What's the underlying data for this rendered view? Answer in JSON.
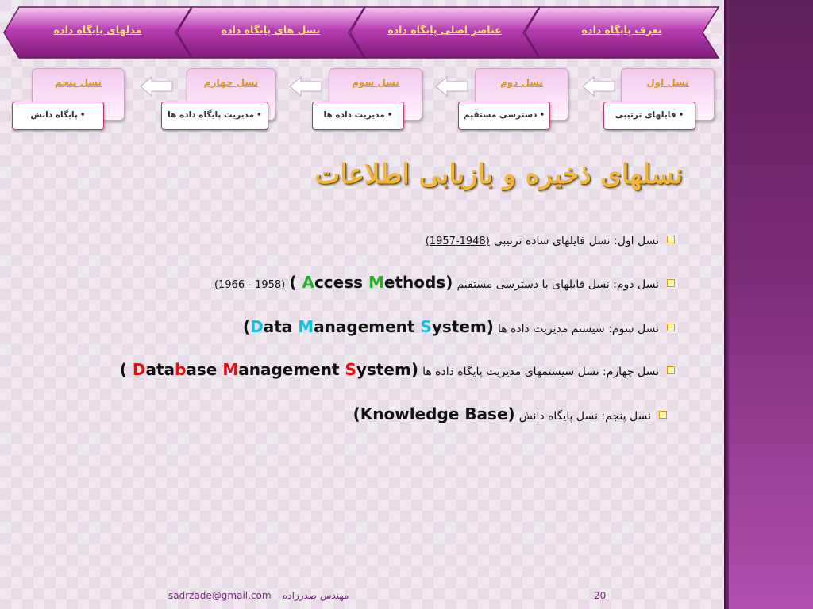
{
  "colors": {
    "accent_purple": "#8a2a85",
    "tab_text": "#ffe770",
    "title": "#f0b83a",
    "bullet": "#d3a000"
  },
  "nav_tabs": [
    {
      "label": "مدلهای پایگاه داده"
    },
    {
      "label": "نسل های پایگاه داده"
    },
    {
      "label": "عناصر اصلی پایگاه داده"
    },
    {
      "label": "نعرف پایگاه داده"
    }
  ],
  "generations": [
    {
      "label": "نسل پنجم",
      "desc": "پایگاه دانش"
    },
    {
      "label": "نسل چهارم",
      "desc": "مدیریت پایگاه داده ها"
    },
    {
      "label": "نسل سوم",
      "desc": "مدیریت داده ها"
    },
    {
      "label": "نسل دوم",
      "desc": "دسترسی مستقیم"
    },
    {
      "label": "نسل اول",
      "desc": "فایلهای ترتیبی"
    }
  ],
  "title": "نسلهای ذخیره و بازیابی اطلاعات",
  "bullets": {
    "b1": {
      "text": "نسل اول: نسل فایلهای ساده ترتیبی",
      "dates": "(1948-1957)"
    },
    "b2": {
      "text": "نسل دوم: نسل فایلهای با دسترسی مستقیم",
      "open": "(",
      "dates": "(1958 - 1966)",
      "a1": "A",
      "a2": "ccess ",
      "m1": "M",
      "m2": "ethods",
      "close": ")"
    },
    "b3": {
      "text": "نسل سوم: سیستم مدیریت داده ها",
      "open": "(",
      "d1": "D",
      "d2": "ata ",
      "m1": "M",
      "m2": "anagement ",
      "s1": "S",
      "s2": "ystem",
      "close": ")"
    },
    "b4": {
      "text": "نسل چهارم: نسل سیستمهای مدیریت پایگاه داده ها",
      "open": "(",
      "d1": "D",
      "d2": "ata",
      "b1": "b",
      "b2": "ase ",
      "m1": "M",
      "m2": "anagement ",
      "s1": "S",
      "s2": "ystem",
      "close": ")"
    },
    "b5": {
      "text": "نسل پنجم: نسل پایگاه دانش",
      "en": "(Knowledge Base)"
    }
  },
  "footer": {
    "email": "sadrzade@gmail.com",
    "author": "مهندس صدرزاده",
    "page": "20"
  }
}
